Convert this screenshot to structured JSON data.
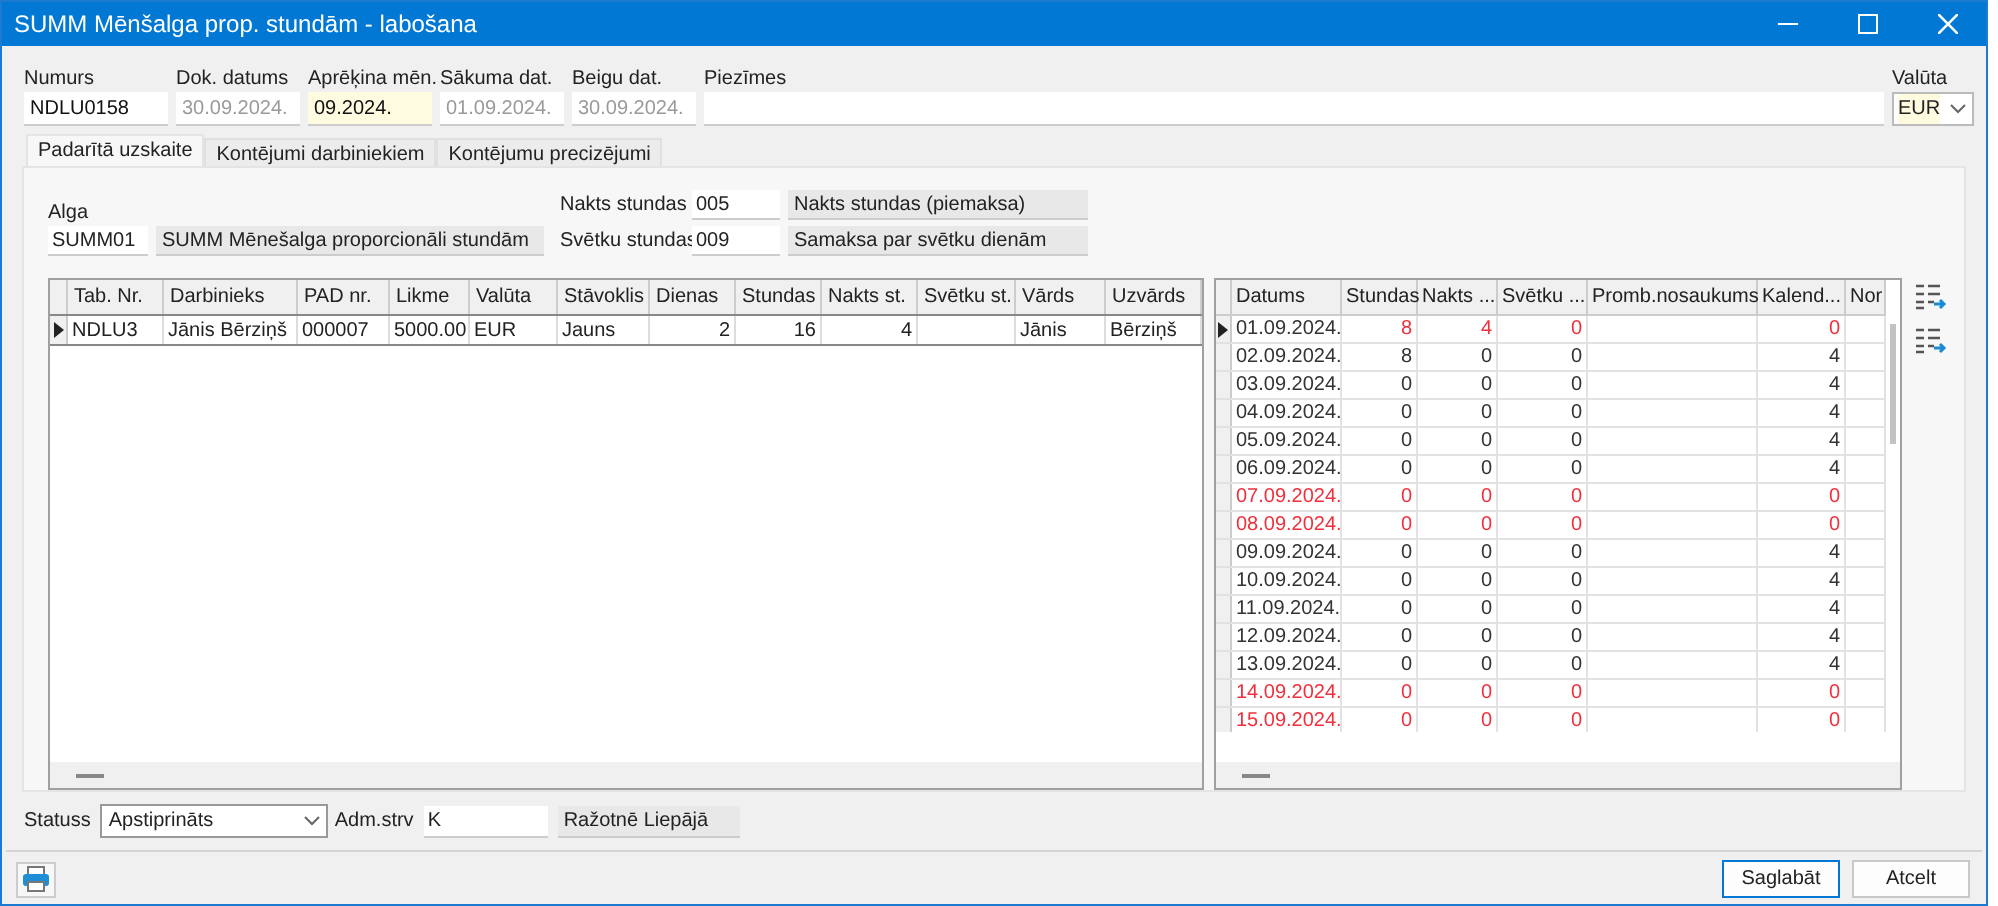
{
  "window": {
    "title": "SUMM Mēnšalga prop. stundām - labošana"
  },
  "header_fields": [
    {
      "label": "Numurs",
      "value": "NDLU0158",
      "disabled": false,
      "highlighted": false
    },
    {
      "label": "Dok. datums",
      "value": "30.09.2024.",
      "disabled": true,
      "highlighted": false
    },
    {
      "label": "Aprēķina mēn.",
      "value": "09.2024.",
      "disabled": false,
      "highlighted": true
    },
    {
      "label": "Sākuma dat.",
      "value": "01.09.2024.",
      "disabled": true,
      "highlighted": false
    },
    {
      "label": "Beigu dat.",
      "value": "30.09.2024.",
      "disabled": true,
      "highlighted": false
    },
    {
      "label": "Piezīmes"
    }
  ],
  "currency": {
    "label": "Valūta",
    "value": "EUR"
  },
  "tabs": [
    {
      "label": "Padarītā uzskaite",
      "selected": true
    },
    {
      "label": "Kontējumi darbiniekiem",
      "selected": false
    },
    {
      "label": "Kontējumu precizējumi",
      "selected": false
    }
  ],
  "salary": {
    "label": "Alga",
    "code": "SUMM01",
    "name": "SUMM Mēnešalga proporcionāli stundām"
  },
  "extra_pay": [
    {
      "label": "Nakts stundas",
      "code": "005",
      "name": "Nakts stundas (piemaksa)"
    },
    {
      "label": "Svētku stundas",
      "code": "009",
      "name": "Samaksa par svētku dienām"
    }
  ],
  "employees_table": {
    "columns": [
      "Tab. Nr.",
      "Darbinieks",
      "PAD nr.",
      "Likme",
      "Valūta",
      "Stāvoklis",
      "Dienas",
      "Stundas",
      "Nakts st.",
      "Svētku st.",
      "Vārds",
      "Uzvārds"
    ],
    "rows": [
      {
        "selected": true,
        "cells": [
          "NDLU3",
          "Jānis Bērziņš",
          "000007",
          "5000.00",
          "EUR",
          "Jauns",
          "2",
          "16",
          "4",
          null,
          "Jānis",
          "Bērziņš"
        ]
      }
    ]
  },
  "days_table": {
    "columns": [
      "Datums",
      "Stundas",
      "Nakts ...",
      "Svētku ...",
      "Promb.nosaukums",
      "Kalend...",
      "Nor"
    ],
    "rows": [
      {
        "selected": true,
        "date_red": false,
        "values_red": true,
        "date": "01.09.2024.",
        "hours": "8",
        "night": "4",
        "holiday": "0",
        "calendar": "0"
      },
      {
        "selected": false,
        "date_red": false,
        "values_red": false,
        "date": "02.09.2024.",
        "hours": "8",
        "night": "0",
        "holiday": "0",
        "calendar": "4"
      },
      {
        "selected": false,
        "date_red": false,
        "values_red": false,
        "date": "03.09.2024.",
        "hours": "0",
        "night": "0",
        "holiday": "0",
        "calendar": "4"
      },
      {
        "selected": false,
        "date_red": false,
        "values_red": false,
        "date": "04.09.2024.",
        "hours": "0",
        "night": "0",
        "holiday": "0",
        "calendar": "4"
      },
      {
        "selected": false,
        "date_red": false,
        "values_red": false,
        "date": "05.09.2024.",
        "hours": "0",
        "night": "0",
        "holiday": "0",
        "calendar": "4"
      },
      {
        "selected": false,
        "date_red": false,
        "values_red": false,
        "date": "06.09.2024.",
        "hours": "0",
        "night": "0",
        "holiday": "0",
        "calendar": "4"
      },
      {
        "selected": false,
        "date_red": true,
        "values_red": true,
        "date": "07.09.2024.",
        "hours": "0",
        "night": "0",
        "holiday": "0",
        "calendar": "0"
      },
      {
        "selected": false,
        "date_red": true,
        "values_red": true,
        "date": "08.09.2024.",
        "hours": "0",
        "night": "0",
        "holiday": "0",
        "calendar": "0"
      },
      {
        "selected": false,
        "date_red": false,
        "values_red": false,
        "date": "09.09.2024.",
        "hours": "0",
        "night": "0",
        "holiday": "0",
        "calendar": "4"
      },
      {
        "selected": false,
        "date_red": false,
        "values_red": false,
        "date": "10.09.2024.",
        "hours": "0",
        "night": "0",
        "holiday": "0",
        "calendar": "4"
      },
      {
        "selected": false,
        "date_red": false,
        "values_red": false,
        "date": "11.09.2024.",
        "hours": "0",
        "night": "0",
        "holiday": "0",
        "calendar": "4"
      },
      {
        "selected": false,
        "date_red": false,
        "values_red": false,
        "date": "12.09.2024.",
        "hours": "0",
        "night": "0",
        "holiday": "0",
        "calendar": "4"
      },
      {
        "selected": false,
        "date_red": false,
        "values_red": false,
        "date": "13.09.2024.",
        "hours": "0",
        "night": "0",
        "holiday": "0",
        "calendar": "4"
      },
      {
        "selected": false,
        "date_red": true,
        "values_red": true,
        "date": "14.09.2024.",
        "hours": "0",
        "night": "0",
        "holiday": "0",
        "calendar": "0"
      },
      {
        "selected": false,
        "date_red": true,
        "values_red": true,
        "date": "15.09.2024.",
        "hours": "0",
        "night": "0",
        "holiday": "0",
        "calendar": "0"
      }
    ]
  },
  "status": {
    "label": "Statuss",
    "value": "Apstiprināts"
  },
  "admin_unit": {
    "label": "Adm.strv",
    "code": "K",
    "name": "Ražotnē Liepājā"
  },
  "buttons": [
    {
      "label": "Saglabāt",
      "default": true
    },
    {
      "label": "Atcelt",
      "default": false
    }
  ]
}
